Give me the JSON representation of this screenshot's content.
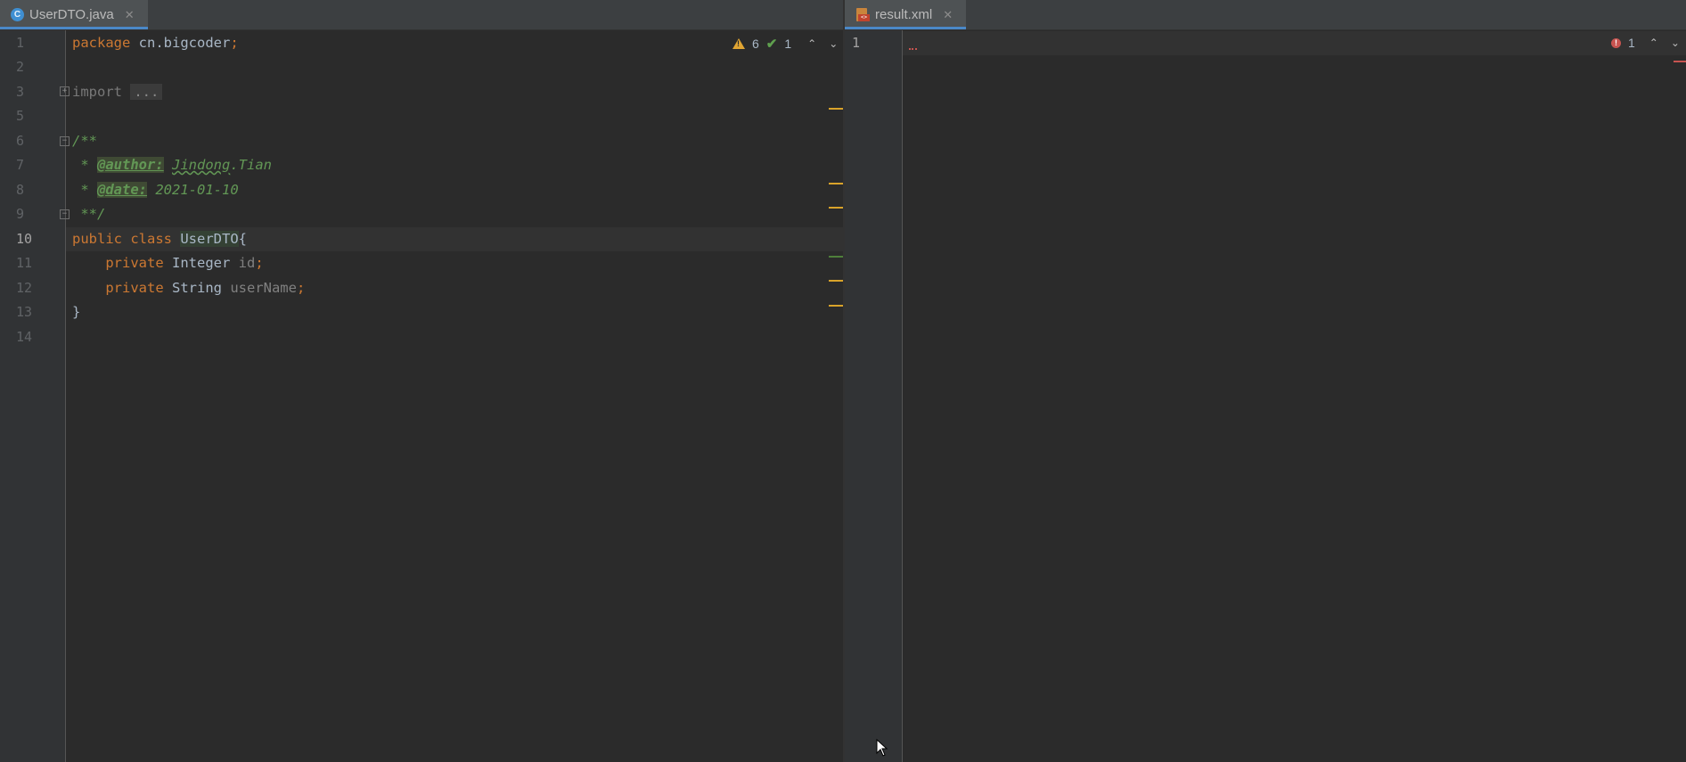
{
  "left_editor": {
    "tab": {
      "label": "UserDTO.java",
      "icon": "java-class-icon"
    },
    "inspection": {
      "warnings": "6",
      "weak_warnings": "1"
    },
    "line_numbers": [
      "1",
      "2",
      "3",
      "5",
      "6",
      "7",
      "8",
      "9",
      "10",
      "11",
      "12",
      "13",
      "14"
    ],
    "current_line": "10",
    "code": {
      "l1_kw": "package",
      "l1_pkg": "cn.bigcoder",
      "l1_semi": ";",
      "l3_kw": "import",
      "l3_fold": "...",
      "l6": "/**",
      "l7_star": " * ",
      "l7_tag": "@author:",
      "l7_text": "Jindong",
      "l7_rest": ".Tian",
      "l8_star": " * ",
      "l8_tag": "@date:",
      "l8_text": " 2021-01-10",
      "l9": " **/",
      "l10_kw": "public class ",
      "l10_name": "UserDTO",
      "l10_brace": "{",
      "l11_indent": "    ",
      "l11_kw": "private",
      "l11_type": " Integer ",
      "l11_field": "id",
      "l11_semi": ";",
      "l12_indent": "    ",
      "l12_kw": "private",
      "l12_type": " String ",
      "l12_field": "userName",
      "l12_semi": ";",
      "l13": "}"
    }
  },
  "right_editor": {
    "tab": {
      "label": "result.xml",
      "icon": "xml-file-icon"
    },
    "inspection": {
      "errors": "1"
    },
    "line_numbers": [
      "1"
    ],
    "current_line": "1"
  },
  "colors": {
    "background": "#2b2b2b",
    "gutter": "#313335",
    "keyword": "#cc7832",
    "comment": "#629755",
    "warning": "#e0a533",
    "error": "#c75450"
  }
}
